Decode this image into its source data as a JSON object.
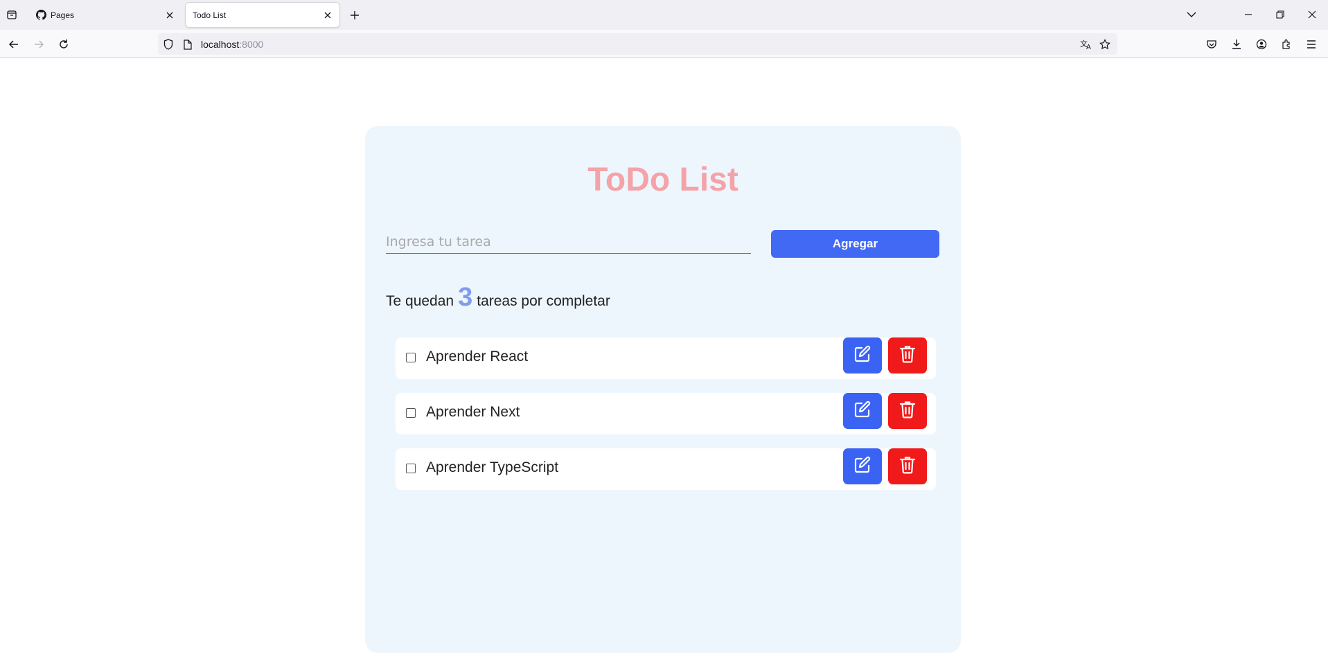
{
  "browser": {
    "tabs": [
      {
        "title": "Pages",
        "icon": "github-icon",
        "active": false
      },
      {
        "title": "Todo List",
        "icon": "",
        "active": true
      }
    ],
    "url": {
      "host": "localhost",
      "port": ":8000"
    }
  },
  "app": {
    "title": "ToDo List",
    "input": {
      "placeholder": "Ingresa tu tarea",
      "value": ""
    },
    "add_button": "Agregar",
    "remaining": {
      "prefix": "Te quedan",
      "count": "3",
      "suffix": "tareas por completar"
    },
    "todos": [
      {
        "text": "Aprender React",
        "done": false
      },
      {
        "text": "Aprender Next",
        "done": false
      },
      {
        "text": "Aprender TypeScript",
        "done": false
      }
    ]
  },
  "colors": {
    "title": "#f4a3a8",
    "primary": "#4169f4",
    "danger": "#f11a1a",
    "card": "#eef6fd",
    "count": "#7e9cf1"
  }
}
